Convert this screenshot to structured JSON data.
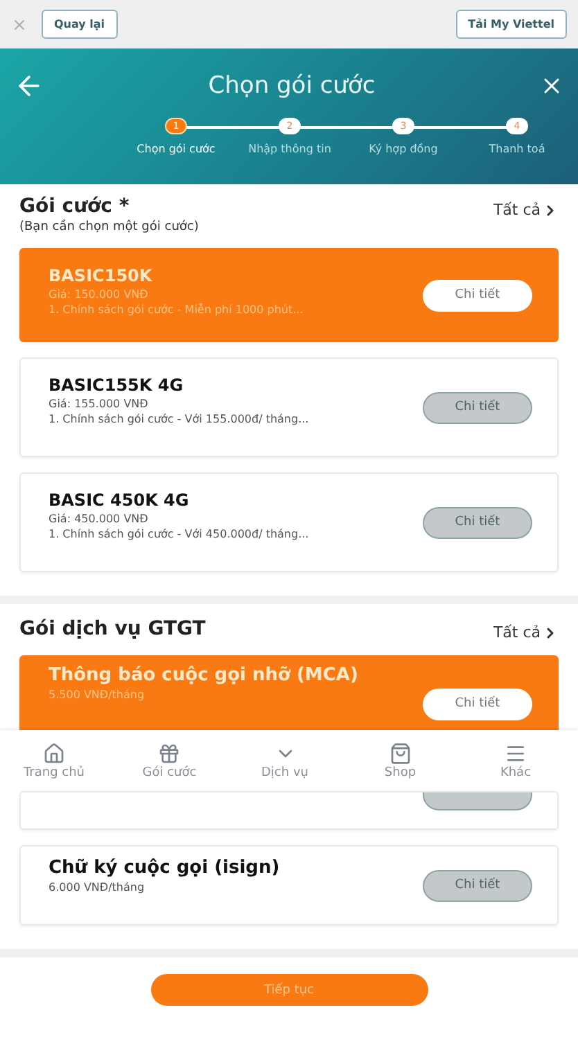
{
  "browser_bar": {
    "back_button": "Quay lại",
    "app_button": "Tải My Viettel"
  },
  "header": {
    "title": "Chọn gói cước"
  },
  "steps": [
    {
      "number": "1",
      "label": "Chọn gói cước",
      "selected": true
    },
    {
      "number": "2",
      "label": "Nhập thông tin",
      "selected": false
    },
    {
      "number": "3",
      "label": "Ký hợp đồng",
      "selected": false
    },
    {
      "number": "4",
      "label": "Thanh toá",
      "selected": false
    }
  ],
  "packages": {
    "title": "Gói cước *",
    "subtitle": "(Bạn cần chọn một gói cước)",
    "all_link": "Tất cả",
    "items": [
      {
        "name": "BASIC150K",
        "price": "Giá: 150.000 VNĐ",
        "policy": "1. Chính sách gói cước - Miễn phí 1000 phút...",
        "button": "Chi tiết",
        "selected": true
      },
      {
        "name": "BASIC155K 4G",
        "price": "Giá: 155.000 VNĐ",
        "policy": "1. Chính sách gói cước - Với 155.000đ/ tháng...",
        "button": "Chi tiết",
        "selected": false
      },
      {
        "name": "BASIC 450K 4G",
        "price": "Giá: 450.000 VNĐ",
        "policy": "1. Chính sách gói cước - Với 450.000đ/ tháng...",
        "button": "Chi tiết",
        "selected": false
      }
    ]
  },
  "services": {
    "title": "Gói dịch vụ GTGT",
    "all_link": "Tất cả",
    "items": [
      {
        "name": "Thông báo cuộc gọi nhỡ (MCA)",
        "price": "5.500 VNĐ/tháng",
        "button": "Chi tiết",
        "selected": true
      },
      {
        "selected": false
      },
      {
        "name": "Chữ ký cuộc gọi (isign)",
        "price": "6.000 VNĐ/tháng",
        "button": "Chi tiết",
        "selected": false
      }
    ]
  },
  "bottom_nav": [
    {
      "kind": "home",
      "label": "Trang chủ"
    },
    {
      "kind": "gift",
      "label": "Gói cước"
    },
    {
      "kind": "chevron",
      "label": "Dịch vụ"
    },
    {
      "kind": "bag",
      "label": "Shop"
    },
    {
      "kind": "menu",
      "label": "Khác"
    }
  ],
  "continue_button": "Tiếp tục"
}
